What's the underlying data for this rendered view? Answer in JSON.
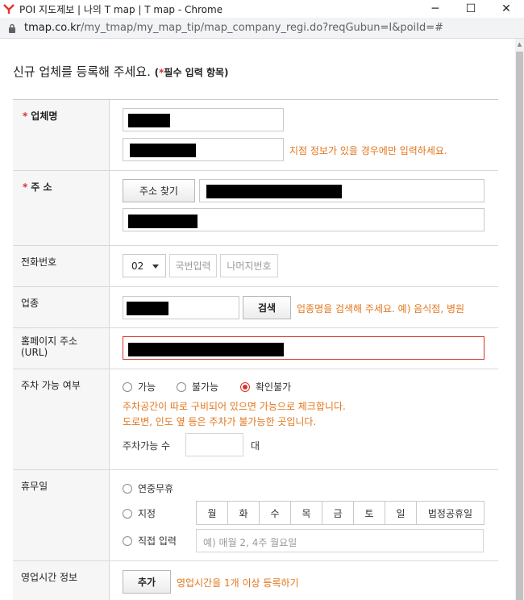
{
  "window": {
    "title": "POI 지도제보 | 나의 T map | T map - Chrome",
    "minimize": "─",
    "maximize": "☐",
    "close": "✕"
  },
  "address": {
    "host": "tmap.co.kr",
    "path": "/my_tmap/my_map_tip/map_company_regi.do?reqGubun=I&poiId=#"
  },
  "page": {
    "heading": "신규 업체를 등록해 주세요.",
    "required_note_open": "(",
    "required_star": "*",
    "required_note_text": "필수 입력 항목)"
  },
  "form": {
    "name": {
      "star": "*",
      "label": "업체명",
      "branch_hint": "지점 정보가 있을 경우에만 입력하세요."
    },
    "address": {
      "star": "*",
      "label": "주 소",
      "find_button": "주소 찾기"
    },
    "phone": {
      "label": "전화번호",
      "area_code": "02",
      "prefix_placeholder": "국번입력",
      "rest_placeholder": "나머지번호"
    },
    "category": {
      "label": "업종",
      "search_button": "검색",
      "hint": "업종명을 검색해 주세요. 예) 음식점, 병원"
    },
    "homepage": {
      "label_line1": "홈페이지 주소",
      "label_line2": "(URL)"
    },
    "parking": {
      "label": "주차 가능 여부",
      "options": [
        "가능",
        "불가능",
        "확인불가"
      ],
      "selected": "확인불가",
      "note1": "주차공간이 따로 구비되어 있으면 가능으로 체크합니다.",
      "note2": "도로변, 인도 옆 등은 주차가 불가능한 곳입니다.",
      "count_label": "주차가능 수",
      "count_unit": "대"
    },
    "holiday": {
      "label": "휴무일",
      "option_year_round": "연중무휴",
      "option_specify": "지정",
      "option_direct": "직접 입력",
      "days": [
        "월",
        "화",
        "수",
        "목",
        "금",
        "토",
        "일",
        "법정공휴일"
      ],
      "direct_placeholder": "예) 매월 2, 4주 월요일"
    },
    "hours": {
      "label": "영업시간 정보",
      "add_button": "추가",
      "hint": "영업시간을 1개 이상 등록하기"
    }
  },
  "colors": {
    "accent_red": "#d9312b",
    "hint_orange": "#e2761d"
  }
}
